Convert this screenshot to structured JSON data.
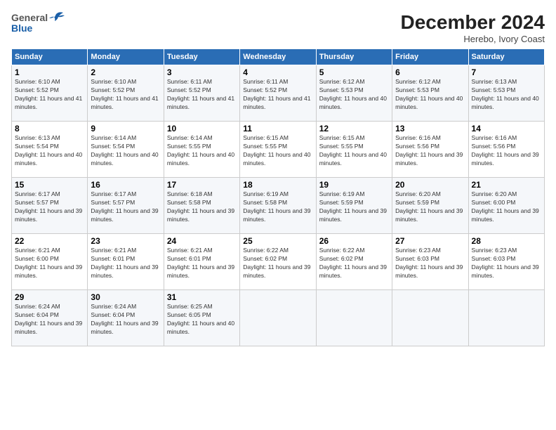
{
  "header": {
    "logo_general": "General",
    "logo_blue": "Blue",
    "title": "December 2024",
    "subtitle": "Herebo, Ivory Coast"
  },
  "calendar": {
    "days_of_week": [
      "Sunday",
      "Monday",
      "Tuesday",
      "Wednesday",
      "Thursday",
      "Friday",
      "Saturday"
    ],
    "weeks": [
      [
        null,
        {
          "day": "2",
          "sunrise": "Sunrise: 6:10 AM",
          "sunset": "Sunset: 5:52 PM",
          "daylight": "Daylight: 11 hours and 41 minutes."
        },
        {
          "day": "3",
          "sunrise": "Sunrise: 6:11 AM",
          "sunset": "Sunset: 5:52 PM",
          "daylight": "Daylight: 11 hours and 41 minutes."
        },
        {
          "day": "4",
          "sunrise": "Sunrise: 6:11 AM",
          "sunset": "Sunset: 5:52 PM",
          "daylight": "Daylight: 11 hours and 41 minutes."
        },
        {
          "day": "5",
          "sunrise": "Sunrise: 6:12 AM",
          "sunset": "Sunset: 5:53 PM",
          "daylight": "Daylight: 11 hours and 40 minutes."
        },
        {
          "day": "6",
          "sunrise": "Sunrise: 6:12 AM",
          "sunset": "Sunset: 5:53 PM",
          "daylight": "Daylight: 11 hours and 40 minutes."
        },
        {
          "day": "7",
          "sunrise": "Sunrise: 6:13 AM",
          "sunset": "Sunset: 5:53 PM",
          "daylight": "Daylight: 11 hours and 40 minutes."
        }
      ],
      [
        {
          "day": "1",
          "sunrise": "Sunrise: 6:10 AM",
          "sunset": "Sunset: 5:52 PM",
          "daylight": "Daylight: 11 hours and 41 minutes."
        },
        {
          "day": "9",
          "sunrise": "Sunrise: 6:14 AM",
          "sunset": "Sunset: 5:54 PM",
          "daylight": "Daylight: 11 hours and 40 minutes."
        },
        {
          "day": "10",
          "sunrise": "Sunrise: 6:14 AM",
          "sunset": "Sunset: 5:55 PM",
          "daylight": "Daylight: 11 hours and 40 minutes."
        },
        {
          "day": "11",
          "sunrise": "Sunrise: 6:15 AM",
          "sunset": "Sunset: 5:55 PM",
          "daylight": "Daylight: 11 hours and 40 minutes."
        },
        {
          "day": "12",
          "sunrise": "Sunrise: 6:15 AM",
          "sunset": "Sunset: 5:55 PM",
          "daylight": "Daylight: 11 hours and 40 minutes."
        },
        {
          "day": "13",
          "sunrise": "Sunrise: 6:16 AM",
          "sunset": "Sunset: 5:56 PM",
          "daylight": "Daylight: 11 hours and 39 minutes."
        },
        {
          "day": "14",
          "sunrise": "Sunrise: 6:16 AM",
          "sunset": "Sunset: 5:56 PM",
          "daylight": "Daylight: 11 hours and 39 minutes."
        }
      ],
      [
        {
          "day": "8",
          "sunrise": "Sunrise: 6:13 AM",
          "sunset": "Sunset: 5:54 PM",
          "daylight": "Daylight: 11 hours and 40 minutes."
        },
        {
          "day": "16",
          "sunrise": "Sunrise: 6:17 AM",
          "sunset": "Sunset: 5:57 PM",
          "daylight": "Daylight: 11 hours and 39 minutes."
        },
        {
          "day": "17",
          "sunrise": "Sunrise: 6:18 AM",
          "sunset": "Sunset: 5:58 PM",
          "daylight": "Daylight: 11 hours and 39 minutes."
        },
        {
          "day": "18",
          "sunrise": "Sunrise: 6:19 AM",
          "sunset": "Sunset: 5:58 PM",
          "daylight": "Daylight: 11 hours and 39 minutes."
        },
        {
          "day": "19",
          "sunrise": "Sunrise: 6:19 AM",
          "sunset": "Sunset: 5:59 PM",
          "daylight": "Daylight: 11 hours and 39 minutes."
        },
        {
          "day": "20",
          "sunrise": "Sunrise: 6:20 AM",
          "sunset": "Sunset: 5:59 PM",
          "daylight": "Daylight: 11 hours and 39 minutes."
        },
        {
          "day": "21",
          "sunrise": "Sunrise: 6:20 AM",
          "sunset": "Sunset: 6:00 PM",
          "daylight": "Daylight: 11 hours and 39 minutes."
        }
      ],
      [
        {
          "day": "15",
          "sunrise": "Sunrise: 6:17 AM",
          "sunset": "Sunset: 5:57 PM",
          "daylight": "Daylight: 11 hours and 39 minutes."
        },
        {
          "day": "23",
          "sunrise": "Sunrise: 6:21 AM",
          "sunset": "Sunset: 6:01 PM",
          "daylight": "Daylight: 11 hours and 39 minutes."
        },
        {
          "day": "24",
          "sunrise": "Sunrise: 6:21 AM",
          "sunset": "Sunset: 6:01 PM",
          "daylight": "Daylight: 11 hours and 39 minutes."
        },
        {
          "day": "25",
          "sunrise": "Sunrise: 6:22 AM",
          "sunset": "Sunset: 6:02 PM",
          "daylight": "Daylight: 11 hours and 39 minutes."
        },
        {
          "day": "26",
          "sunrise": "Sunrise: 6:22 AM",
          "sunset": "Sunset: 6:02 PM",
          "daylight": "Daylight: 11 hours and 39 minutes."
        },
        {
          "day": "27",
          "sunrise": "Sunrise: 6:23 AM",
          "sunset": "Sunset: 6:03 PM",
          "daylight": "Daylight: 11 hours and 39 minutes."
        },
        {
          "day": "28",
          "sunrise": "Sunrise: 6:23 AM",
          "sunset": "Sunset: 6:03 PM",
          "daylight": "Daylight: 11 hours and 39 minutes."
        }
      ],
      [
        {
          "day": "22",
          "sunrise": "Sunrise: 6:21 AM",
          "sunset": "Sunset: 6:00 PM",
          "daylight": "Daylight: 11 hours and 39 minutes."
        },
        {
          "day": "30",
          "sunrise": "Sunrise: 6:24 AM",
          "sunset": "Sunset: 6:04 PM",
          "daylight": "Daylight: 11 hours and 39 minutes."
        },
        {
          "day": "31",
          "sunrise": "Sunrise: 6:25 AM",
          "sunset": "Sunset: 6:05 PM",
          "daylight": "Daylight: 11 hours and 40 minutes."
        },
        null,
        null,
        null,
        null
      ],
      [
        {
          "day": "29",
          "sunrise": "Sunrise: 6:24 AM",
          "sunset": "Sunset: 6:04 PM",
          "daylight": "Daylight: 11 hours and 39 minutes."
        },
        null,
        null,
        null,
        null,
        null,
        null
      ]
    ]
  }
}
